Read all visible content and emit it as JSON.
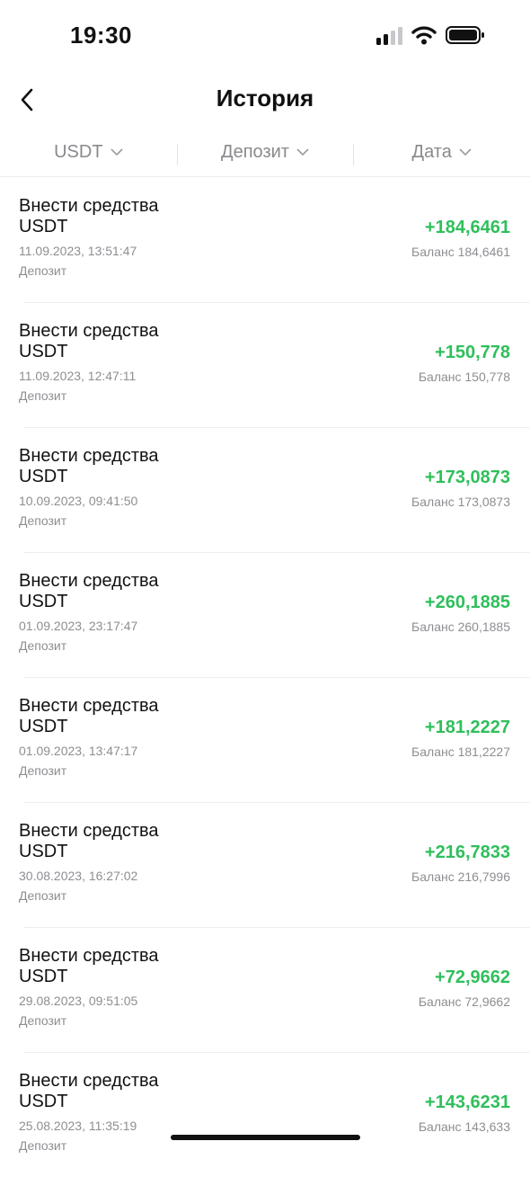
{
  "status": {
    "time": "19:30"
  },
  "header": {
    "title": "История"
  },
  "filters": [
    {
      "label": "USDT"
    },
    {
      "label": "Депозит"
    },
    {
      "label": "Дата"
    }
  ],
  "transactions": [
    {
      "title": "Внести средства",
      "currency": "USDT",
      "date": "11.09.2023, 13:51:47",
      "type": "Депозит",
      "amount": "+184,6461",
      "balance": "Баланс 184,6461"
    },
    {
      "title": "Внести средства",
      "currency": "USDT",
      "date": "11.09.2023, 12:47:11",
      "type": "Депозит",
      "amount": "+150,778",
      "balance": "Баланс 150,778"
    },
    {
      "title": "Внести средства",
      "currency": "USDT",
      "date": "10.09.2023, 09:41:50",
      "type": "Депозит",
      "amount": "+173,0873",
      "balance": "Баланс 173,0873"
    },
    {
      "title": "Внести средства",
      "currency": "USDT",
      "date": "01.09.2023, 23:17:47",
      "type": "Депозит",
      "amount": "+260,1885",
      "balance": "Баланс 260,1885"
    },
    {
      "title": "Внести средства",
      "currency": "USDT",
      "date": "01.09.2023, 13:47:17",
      "type": "Депозит",
      "amount": "+181,2227",
      "balance": "Баланс 181,2227"
    },
    {
      "title": "Внести средства",
      "currency": "USDT",
      "date": "30.08.2023, 16:27:02",
      "type": "Депозит",
      "amount": "+216,7833",
      "balance": "Баланс 216,7996"
    },
    {
      "title": "Внести средства",
      "currency": "USDT",
      "date": "29.08.2023, 09:51:05",
      "type": "Депозит",
      "amount": "+72,9662",
      "balance": "Баланс 72,9662"
    },
    {
      "title": "Внести средства",
      "currency": "USDT",
      "date": "25.08.2023, 11:35:19",
      "type": "Депозит",
      "amount": "+143,6231",
      "balance": "Баланс 143,633"
    }
  ],
  "colors": {
    "positive": "#2fbf5b",
    "muted": "#8e8e93"
  }
}
